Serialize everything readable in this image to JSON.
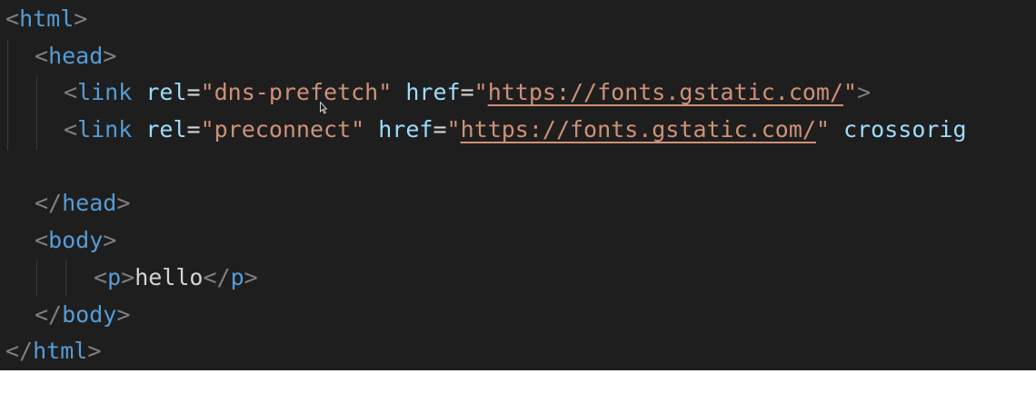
{
  "code": {
    "lines": [
      {
        "parts": [
          {
            "k": "bracket",
            "v": "<"
          },
          {
            "k": "tag",
            "v": "html"
          },
          {
            "k": "bracket",
            "v": ">"
          }
        ]
      },
      {
        "parts": [
          {
            "k": "bracket",
            "v": "<"
          },
          {
            "k": "tag",
            "v": "head"
          },
          {
            "k": "bracket",
            "v": ">"
          }
        ]
      },
      {
        "parts": [
          {
            "k": "bracket",
            "v": "<"
          },
          {
            "k": "tag",
            "v": "link"
          },
          {
            "k": "text",
            "v": " "
          },
          {
            "k": "attr",
            "v": "rel"
          },
          {
            "k": "eq",
            "v": "="
          },
          {
            "k": "str",
            "v": "\"dns-prefetch\""
          },
          {
            "k": "text",
            "v": " "
          },
          {
            "k": "attr",
            "v": "href"
          },
          {
            "k": "eq",
            "v": "="
          },
          {
            "k": "str",
            "v": "\""
          },
          {
            "k": "url",
            "v": "https://fonts.gstatic.com/"
          },
          {
            "k": "str",
            "v": "\""
          },
          {
            "k": "bracket",
            "v": ">"
          }
        ]
      },
      {
        "parts": [
          {
            "k": "bracket",
            "v": "<"
          },
          {
            "k": "tag",
            "v": "link"
          },
          {
            "k": "text",
            "v": " "
          },
          {
            "k": "attr",
            "v": "rel"
          },
          {
            "k": "eq",
            "v": "="
          },
          {
            "k": "str",
            "v": "\"preconnect\""
          },
          {
            "k": "text",
            "v": " "
          },
          {
            "k": "attr",
            "v": "href"
          },
          {
            "k": "eq",
            "v": "="
          },
          {
            "k": "str",
            "v": "\""
          },
          {
            "k": "url",
            "v": "https://fonts.gstatic.com/"
          },
          {
            "k": "str",
            "v": "\""
          },
          {
            "k": "text",
            "v": " "
          },
          {
            "k": "attr",
            "v": "crossorig"
          }
        ]
      },
      {
        "parts": []
      },
      {
        "parts": [
          {
            "k": "bracket",
            "v": "</"
          },
          {
            "k": "tag",
            "v": "head"
          },
          {
            "k": "bracket",
            "v": ">"
          }
        ]
      },
      {
        "parts": [
          {
            "k": "bracket",
            "v": "<"
          },
          {
            "k": "tag",
            "v": "body"
          },
          {
            "k": "bracket",
            "v": ">"
          }
        ]
      },
      {
        "parts": [
          {
            "k": "bracket",
            "v": "<"
          },
          {
            "k": "tag",
            "v": "p"
          },
          {
            "k": "bracket",
            "v": ">"
          },
          {
            "k": "text",
            "v": "hello"
          },
          {
            "k": "bracket",
            "v": "</"
          },
          {
            "k": "tag",
            "v": "p"
          },
          {
            "k": "bracket",
            "v": ">"
          }
        ]
      },
      {
        "parts": [
          {
            "k": "bracket",
            "v": "</"
          },
          {
            "k": "tag",
            "v": "body"
          },
          {
            "k": "bracket",
            "v": ">"
          }
        ]
      },
      {
        "parts": [
          {
            "k": "bracket",
            "v": "</"
          },
          {
            "k": "tag",
            "v": "html"
          },
          {
            "k": "bracket",
            "v": ">"
          }
        ]
      }
    ]
  },
  "colors": {
    "background": "#1e1e1e",
    "bracket": "#808080",
    "tag": "#569cd6",
    "attribute": "#9cdcfe",
    "string": "#ce9178",
    "text": "#d4d4d4"
  },
  "icons": {
    "mouse_cursor": "arrow-cursor-icon"
  }
}
